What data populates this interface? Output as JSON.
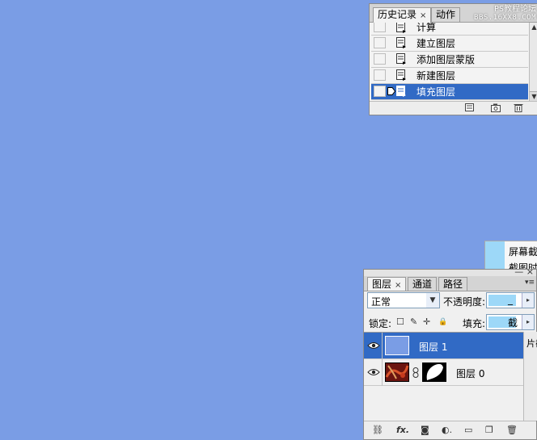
{
  "canvas": {
    "background_color": "#7a9de5"
  },
  "history_panel": {
    "tabs": [
      {
        "label": "历史记录",
        "close": "×"
      },
      {
        "label": "动作"
      }
    ],
    "watermark": {
      "line1": "PS教程论坛",
      "line2": "BBS.16XX8.COM"
    },
    "items": [
      {
        "label": "计算"
      },
      {
        "label": "建立图层"
      },
      {
        "label": "添加图层蒙版"
      },
      {
        "label": "新建图层"
      },
      {
        "label": "填充图层"
      }
    ],
    "selected_index": 4,
    "scroll_up": "▲",
    "scroll_down": "▼",
    "bottom_icons": [
      "new-document-from-state-icon",
      "create-snapshot-icon",
      "delete-icon"
    ]
  },
  "screenshot_panel": {
    "line1": "屏幕截",
    "line2": "截图时"
  },
  "layers_panel": {
    "header_buttons": "— ×",
    "tabs": [
      {
        "label": "图层",
        "close": "×"
      },
      {
        "label": "通道"
      },
      {
        "label": "路径"
      }
    ],
    "menu_button": "▾≡",
    "blend_mode": "正常",
    "dropdown_arrow": "▼",
    "opacity_label": "不透明度:",
    "opacity_value": "_",
    "lock_label": "锁定:",
    "fill_label": "填充:",
    "fill_value": "截",
    "right_arrow": "▸",
    "side_text": "片截",
    "lock_icons": [
      "☐",
      "✎",
      "✛",
      "🔒"
    ],
    "layers": [
      {
        "name": "图层 1",
        "selected": true
      },
      {
        "name": "图层 0",
        "selected": false
      }
    ],
    "bottom_icons": [
      "⛓",
      "fx.",
      "◙",
      "◐.",
      "▭",
      "❐",
      "🗑"
    ],
    "colors": {
      "selection": "#316ac5",
      "swatch": "#9dd8f8",
      "layer1_fill": "#7a9de5"
    }
  }
}
